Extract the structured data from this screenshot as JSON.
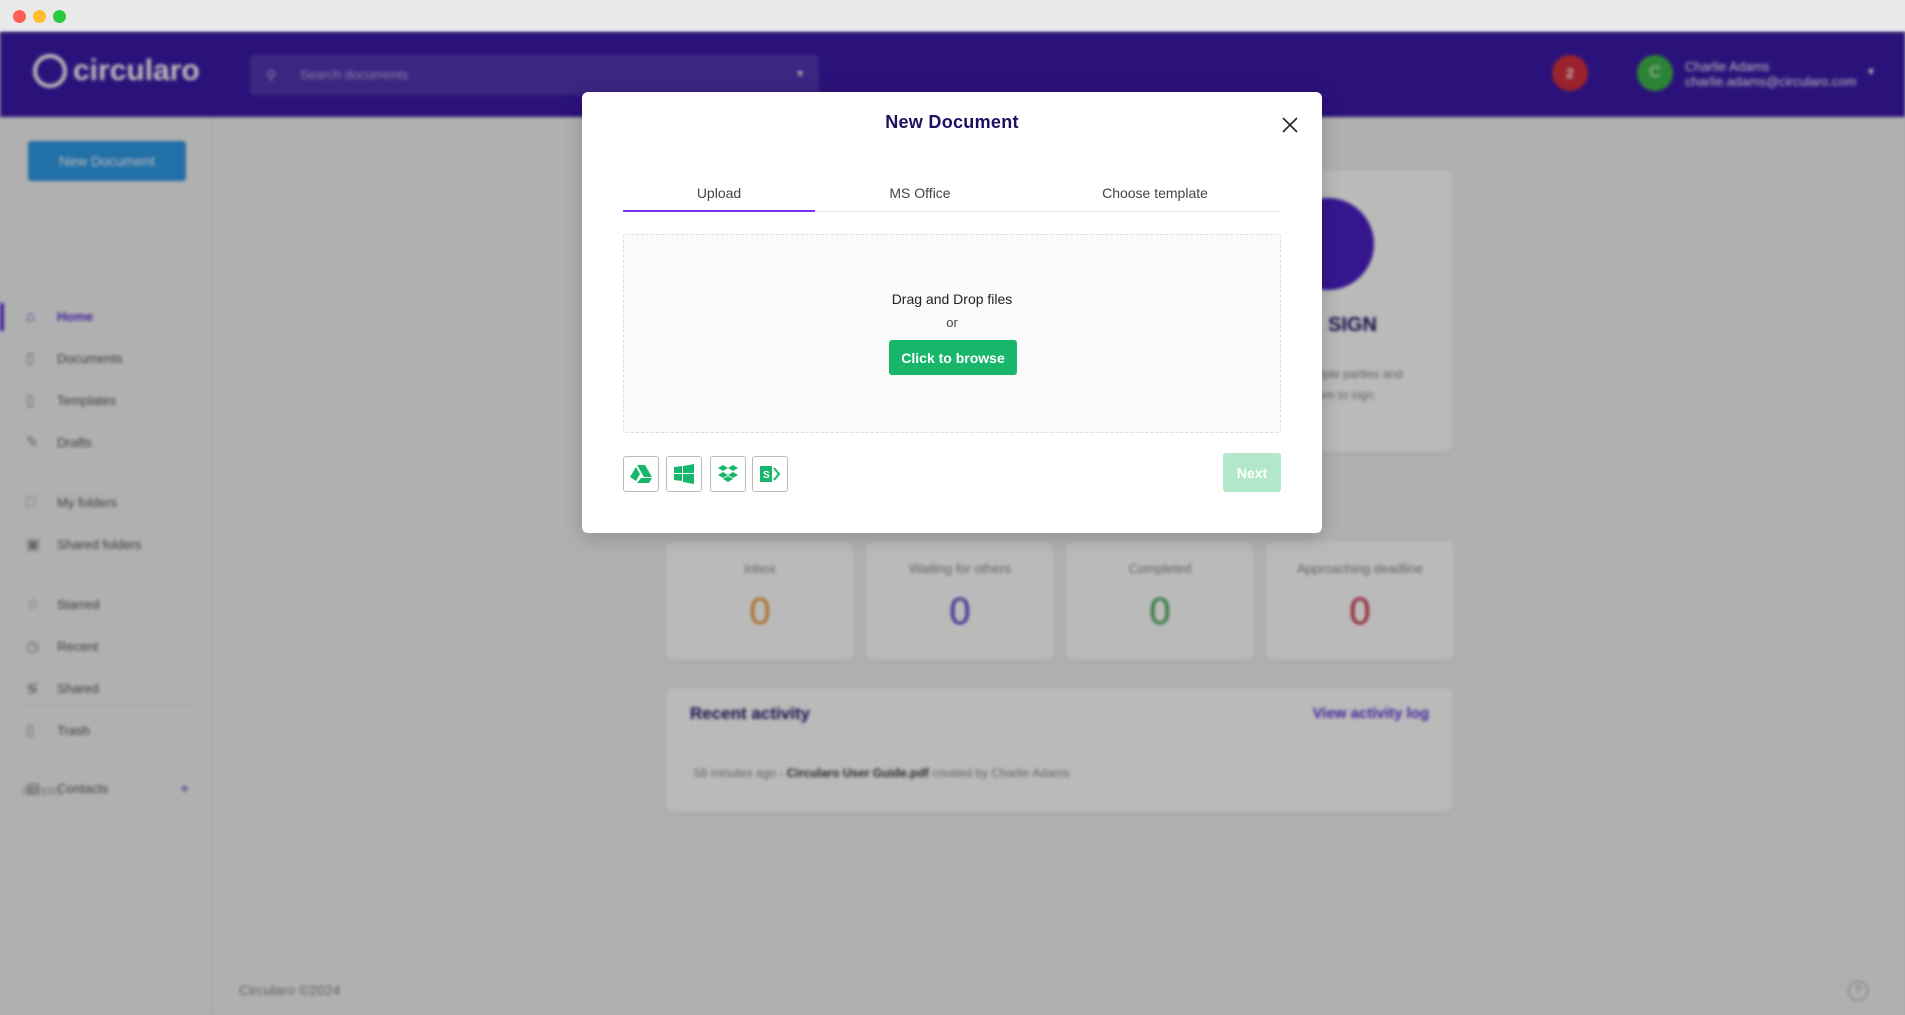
{
  "window": {
    "dots": [
      "#fe5f57",
      "#febc2e",
      "#28c840"
    ]
  },
  "header": {
    "logo_text": "circularo",
    "search_placeholder": "Search documents",
    "notification_count": "2",
    "user": {
      "initial": "C",
      "name": "Charlie Adams",
      "email": "charlie.adams@circularo.com"
    }
  },
  "sidebar": {
    "new_document_label": "New Document",
    "items": [
      {
        "label": "Home",
        "icon": "home-icon",
        "active": true
      },
      {
        "label": "Documents",
        "icon": "document-icon"
      },
      {
        "label": "Templates",
        "icon": "template-icon"
      },
      {
        "label": "Drafts",
        "icon": "edit-icon"
      },
      {
        "label": "My folders",
        "icon": "folder-icon"
      },
      {
        "label": "Shared folders",
        "icon": "shared-folder-icon"
      },
      {
        "label": "Starred",
        "icon": "star-icon"
      },
      {
        "label": "Recent",
        "icon": "clock-icon"
      },
      {
        "label": "Shared",
        "icon": "share-icon"
      },
      {
        "label": "Trash",
        "icon": "trash-icon"
      },
      {
        "label": "Contacts",
        "icon": "contacts-icon"
      }
    ],
    "filters_label": "FILTERS"
  },
  "main": {
    "sign_card": {
      "title": "SIGN",
      "desc_line1": "tiple parties and",
      "desc_line2": "em to sign."
    },
    "stats": [
      {
        "label": "Inbox",
        "value": "0",
        "color": "#e8962e"
      },
      {
        "label": "Waiting for others",
        "value": "0",
        "color": "#5a35c8"
      },
      {
        "label": "Completed",
        "value": "0",
        "color": "#3aa04a"
      },
      {
        "label": "Approaching deadline",
        "value": "0",
        "color": "#c8283c"
      }
    ],
    "recent_activity": {
      "title": "Recent activity",
      "link": "View activity log",
      "entry": {
        "time": "58 minutes ago",
        "sep": "-",
        "file": "Circularo User Guide.pdf",
        "action": "created by Charlie Adams"
      }
    },
    "footer": "Circularo ©2024"
  },
  "modal": {
    "title": "New Document",
    "tabs": [
      {
        "label": "Upload",
        "active": true
      },
      {
        "label": "MS Office"
      },
      {
        "label": "Choose template"
      }
    ],
    "dropzone": {
      "text": "Drag and Drop files",
      "or": "or",
      "browse_label": "Click to browse"
    },
    "sources": [
      "google-drive-icon",
      "onedrive-windows-icon",
      "dropbox-icon",
      "sharepoint-icon"
    ],
    "next_label": "Next",
    "accent": "#17b66a"
  }
}
